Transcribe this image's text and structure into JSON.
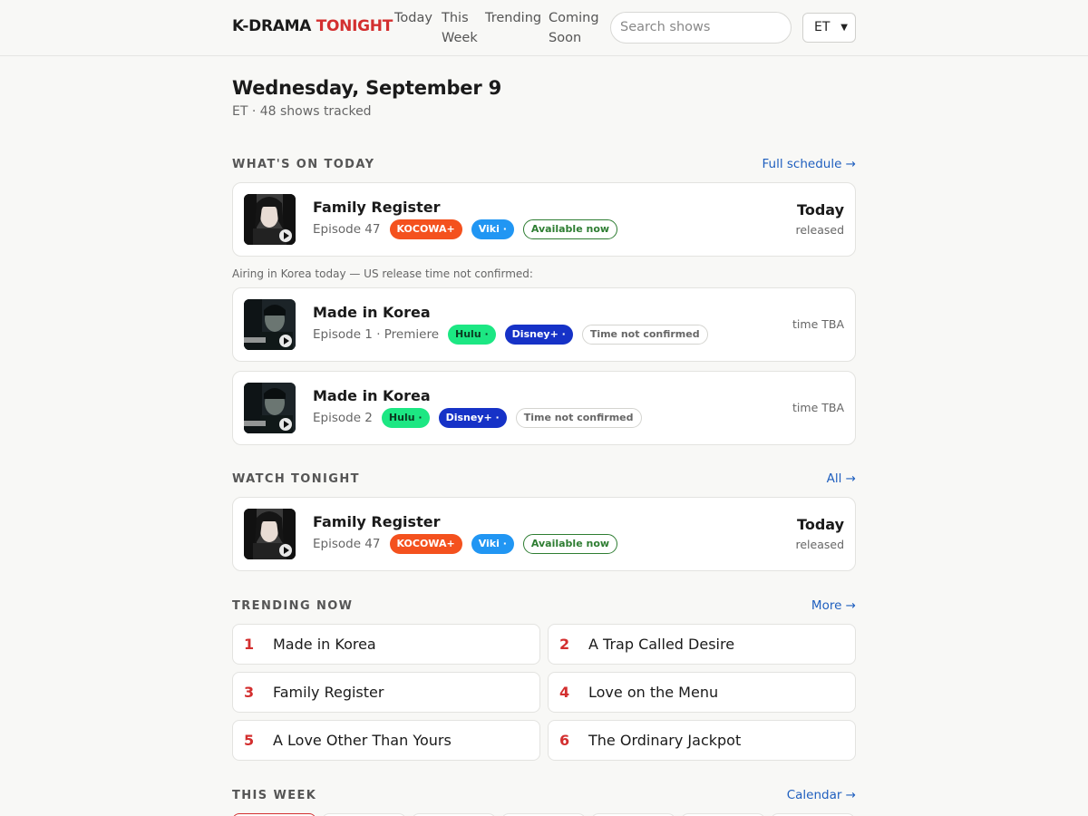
{
  "header": {
    "logo_main": "K-DRAMA",
    "logo_accent": "TONIGHT",
    "nav": [
      "Today",
      "This Week",
      "Trending",
      "Coming Soon"
    ],
    "search_placeholder": "Search shows",
    "timezone": "ET"
  },
  "page": {
    "date_title": "Wednesday, September 9",
    "date_sub": "ET · 48 shows tracked"
  },
  "today": {
    "title": "WHAT'S ON TODAY",
    "link": "Full schedule →",
    "note": "Airing in Korea today — US release time not confirmed:",
    "cards": [
      {
        "title": "Family Register",
        "episode": "Episode 47",
        "badges": [
          "KOCOWA+",
          "Viki ·",
          "Available now"
        ],
        "right_top": "Today",
        "right_bot": "released"
      },
      {
        "title": "Made in Korea",
        "episode": "Episode 1 · Premiere",
        "badges": [
          "Hulu ·",
          "Disney+ ·",
          "Time not confirmed"
        ],
        "right": "time TBA"
      },
      {
        "title": "Made in Korea",
        "episode": "Episode 2",
        "badges": [
          "Hulu ·",
          "Disney+ ·",
          "Time not confirmed"
        ],
        "right": "time TBA"
      }
    ]
  },
  "tonight": {
    "title": "WATCH TONIGHT",
    "link": "All →",
    "card": {
      "title": "Family Register",
      "episode": "Episode 47",
      "badges": [
        "KOCOWA+",
        "Viki ·",
        "Available now"
      ],
      "right_top": "Today",
      "right_bot": "released"
    }
  },
  "trending": {
    "title": "TRENDING NOW",
    "link": "More →",
    "items": [
      {
        "rank": "1",
        "name": "Made in Korea"
      },
      {
        "rank": "2",
        "name": "A Trap Called Desire"
      },
      {
        "rank": "3",
        "name": "Family Register"
      },
      {
        "rank": "4",
        "name": "Love on the Menu"
      },
      {
        "rank": "5",
        "name": "A Love Other Than Yours"
      },
      {
        "rank": "6",
        "name": "The Ordinary Jackpot"
      }
    ]
  },
  "week": {
    "title": "THIS WEEK",
    "link": "Calendar →"
  },
  "colors": {
    "accent": "#d32f2f",
    "link": "#1f5fbf",
    "kocowa": "#f4511e",
    "viki": "#2196f3",
    "hulu": "#1ce783",
    "disney": "#1632c7",
    "available": "#2e7d32"
  }
}
